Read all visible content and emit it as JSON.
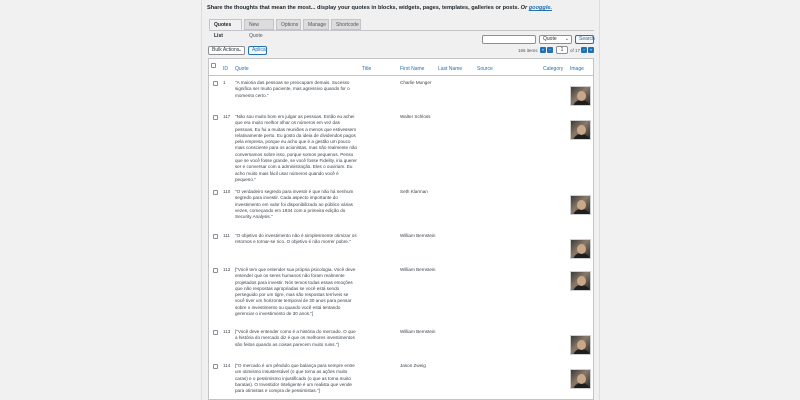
{
  "header": {
    "headline": "Share the thoughts that mean the most... display your quotes in blocks, widgets, pages, templates, galleries or posts.",
    "or_text": "Or",
    "link_text": "googgle."
  },
  "tabs": [
    {
      "label": "Quotes List",
      "active": true
    },
    {
      "label": "New Quote",
      "active": false
    },
    {
      "label": "Options",
      "active": false
    },
    {
      "label": "Manage",
      "active": false
    },
    {
      "label": "Shortcode",
      "active": false
    }
  ],
  "search": {
    "value": "",
    "field_select": "Quote",
    "button": "Search"
  },
  "bulk": {
    "action": "Bulk Actions",
    "apply": "Aplicar"
  },
  "pagination": {
    "items": "166 items",
    "current_page": "1",
    "of_text": "of 17"
  },
  "columns": {
    "id": "ID",
    "quote": "Quote",
    "title": "Title",
    "first_name": "First Name",
    "last_name": "Last Name",
    "source": "Source",
    "category": "Category",
    "image": "Image"
  },
  "rows": [
    {
      "id": "1",
      "quote": "\"A maioria das pessoas se preocupam demais. Sucesso significa ser muito paciente, mas agressivo quando for o momento certo.\"",
      "author": "Charlie Munger",
      "has_image": true
    },
    {
      "id": "117",
      "quote": "\"Não sou muito bom em julgar as pessoas. Então eu achei que era muito melhor olhar os números em vez das pessoas. Eu fui a muitas reuniões a menos que estivessem relativamente perto. Eu gosto da ideia de dividendos pagos pela empresa, porque eu acho que é a gestão um pouco mais consciente para os acionistas, mas não realmente não conversamos sobre isso, porque somos pequenos. Penso que se você fosse grande, se você fosse Fidelity, iria querer ser e conversar com a administração. Eles o ouviriam. Eu acho muito mais fácil usar números quando você é pequeno.\"",
      "author": "Walter Schloss",
      "has_image": true
    },
    {
      "id": "110",
      "quote": "\"O verdadeiro segredo para investir é que não há nenhum segredo para investir. Cada aspecto importante do investimento em valor foi disponibilizado ao público várias vezes, começando em 1934 com a primeira edição do Security Analysis.\"",
      "author": "Seth Klarman",
      "has_image": true
    },
    {
      "id": "111",
      "quote": "\"O objetivo do investimento não é simplesmente otimizar os retornos e tornar-se rico. O objetivo é não morrer pobre.\"",
      "author": "William Bernstein",
      "has_image": true
    },
    {
      "id": "112",
      "quote": "[\"Você tem que entender sua própria psicologia. Você deve entender que os seres humanos não foram realmente projetados para investir. Nós temos todas essas emoções que não respostas apropriadas se você está sendo perseguido por um tigre, mas são respostas terríveis se você tiver um horizonte temporal de 30 anos para pensar sobre o investimento ou quando você está tentando gerenciar o investimento de 30 anos.\"]",
      "author": "William Bernstein",
      "has_image": true
    },
    {
      "id": "113",
      "quote": "[\"Você deve entender como é a história do mercado. O que a história do mercado diz é que os melhores investimentos são feitos quando as coisas parecem muito ruins.\"]",
      "author": "William Bernstein",
      "has_image": true
    },
    {
      "id": "114",
      "quote": "[\"O mercado é um pêndulo que balança para sempre entre um otimismo insustentável (o que torna as ações muito caras) e o pessimismo injustificado (o que as torna muito baratas). O Investidor Inteligente é um realista que vende para otimistas e compra de pessimistas.\"]",
      "author": "Jason Zweig",
      "has_image": true
    }
  ]
}
